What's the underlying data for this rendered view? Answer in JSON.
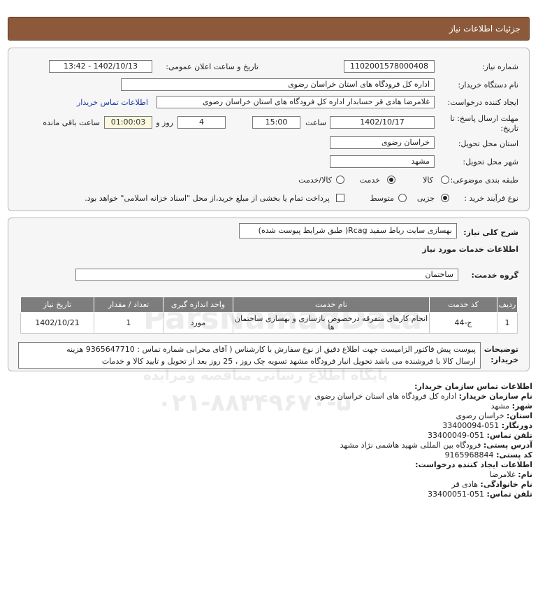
{
  "header": {
    "title": "جزئیات اطلاعات نیاز"
  },
  "need": {
    "number_label": "شماره نیاز:",
    "number": "1102001578000408",
    "announce_label": "تاریخ و ساعت اعلان عمومی:",
    "announce_value": "1402/10/13 - 13:42",
    "buyer_label": "نام دستگاه خریدار:",
    "buyer": "اداره کل فرودگاه های استان خراسان رضوی",
    "creator_label": "ایجاد کننده درخواست:",
    "creator": "غلامرضا هادی قر حسابدار اداره کل فرودگاه های استان خراسان رضوی",
    "contact_link": "اطلاعات تماس خریدار",
    "deadline_label": "مهلت ارسال پاسخ: تا تاریخ:",
    "deadline_date": "1402/10/17",
    "time_label": "ساعت",
    "deadline_time": "15:00",
    "days_value": "4",
    "days_label": "روز و",
    "remaining_time": "01:00:03",
    "remaining_label": "ساعت باقی مانده",
    "province_label": "استان محل تحویل:",
    "province": "خراسان رضوی",
    "city_label": "شهر محل تحویل:",
    "city": "مشهد",
    "category_label": "طبقه بندی موضوعی:",
    "category_options": [
      "کالا",
      "خدمت",
      "کالا/خدمت"
    ],
    "category_selected": "خدمت",
    "process_label": "نوع فرآیند خرید :",
    "process_options": [
      "جزیی",
      "متوسط"
    ],
    "process_selected": "جزیی",
    "treasury_note": "پرداخت تمام یا بخشی از مبلغ خرید،از محل \"اسناد خزانه اسلامی\" خواهد بود."
  },
  "description": {
    "label": "شرح کلی نیاز:",
    "value": "بهسازی سایت رباط سفید Rcag( طبق شرایط پیوست شده)",
    "services_title": "اطلاعات خدمات مورد نیاز",
    "group_label": "گروه خدمت:",
    "group_value": "ساختمان"
  },
  "table": {
    "headers": [
      "ردیف",
      "کد خدمت",
      "نام خدمت",
      "واحد اندازه گیری",
      "تعداد / مقدار",
      "تاریخ نیاز"
    ],
    "rows": [
      [
        "1",
        "ج-44",
        "انجام کارهای متفرقه درخصوص بازسازی و بهسازی ساختمان ها",
        "مورد",
        "1",
        "1402/10/21"
      ]
    ]
  },
  "notes": {
    "label": "توضیحات خریدار:",
    "line1": "پیوست پیش فاکتور الزامیست جهت اطلاع دقیق از نوع سفارش با کارشناس ( آقای محرابی شماره تماس : 9365647710 هزینه",
    "line2": "ارسال کالا با فروشنده می باشد تحویل انبار فرودگاه مشهد تسویه چک روز ، 25 روز بعد از تحویل و تایید کالا و خدمات"
  },
  "buyer_contact": {
    "title": "اطلاعات تماس سازمان خریدار:",
    "org_label": "نام سازمان خریدار:",
    "org": "اداره کل فرودگاه های استان خراسان رضوی",
    "city_label": "شهر:",
    "city": "مشهد",
    "province_label": "استان:",
    "province": "خراسان رضوی",
    "fax_label": "دورنگار:",
    "fax": "051-33400094",
    "phone_label": "تلفن تماس:",
    "phone": "051-33400049",
    "address_label": "آدرس پستی:",
    "address": "فرودگاه بین المللی شهید هاشمی نژاد مشهد",
    "postal_label": "کد پستی:",
    "postal": "9165968844"
  },
  "creator_contact": {
    "title": "اطلاعات ایجاد کننده درخواست:",
    "name_label": "نام:",
    "name": "غلامرضا",
    "family_label": "نام خانوادگی:",
    "family": "هادی قر",
    "phone_label": "تلفن تماس:",
    "phone": "051-33400051"
  },
  "watermark": {
    "line1": "ParsNamadData",
    "line2": "پایگاه اطلاع رسانی مناقصه ومزایده",
    "phone": "۰۲۱-۸۸۳۴۹۶۷۰-۵"
  }
}
